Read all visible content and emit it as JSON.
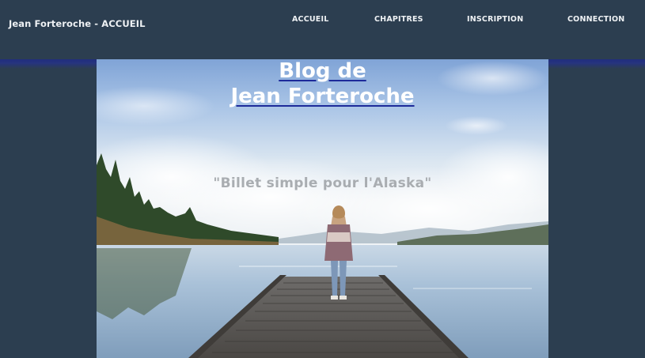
{
  "navbar": {
    "brand": "Jean Forteroche - ACCUEIL",
    "links": [
      {
        "label": "ACCUEIL"
      },
      {
        "label": "CHAPITRES"
      },
      {
        "label": "INSCRIPTION"
      },
      {
        "label": "CONNECTION"
      }
    ]
  },
  "hero": {
    "title_line1": "Blog de",
    "title_line2": "Jean Forteroche",
    "tagline": "\"Billet simple pour l'Alaska\""
  },
  "colors": {
    "page_background": "#2c3e50",
    "nav_text": "#eef1f4",
    "title_underline": "#1d2a9a",
    "tagline": "#a9adb1"
  }
}
